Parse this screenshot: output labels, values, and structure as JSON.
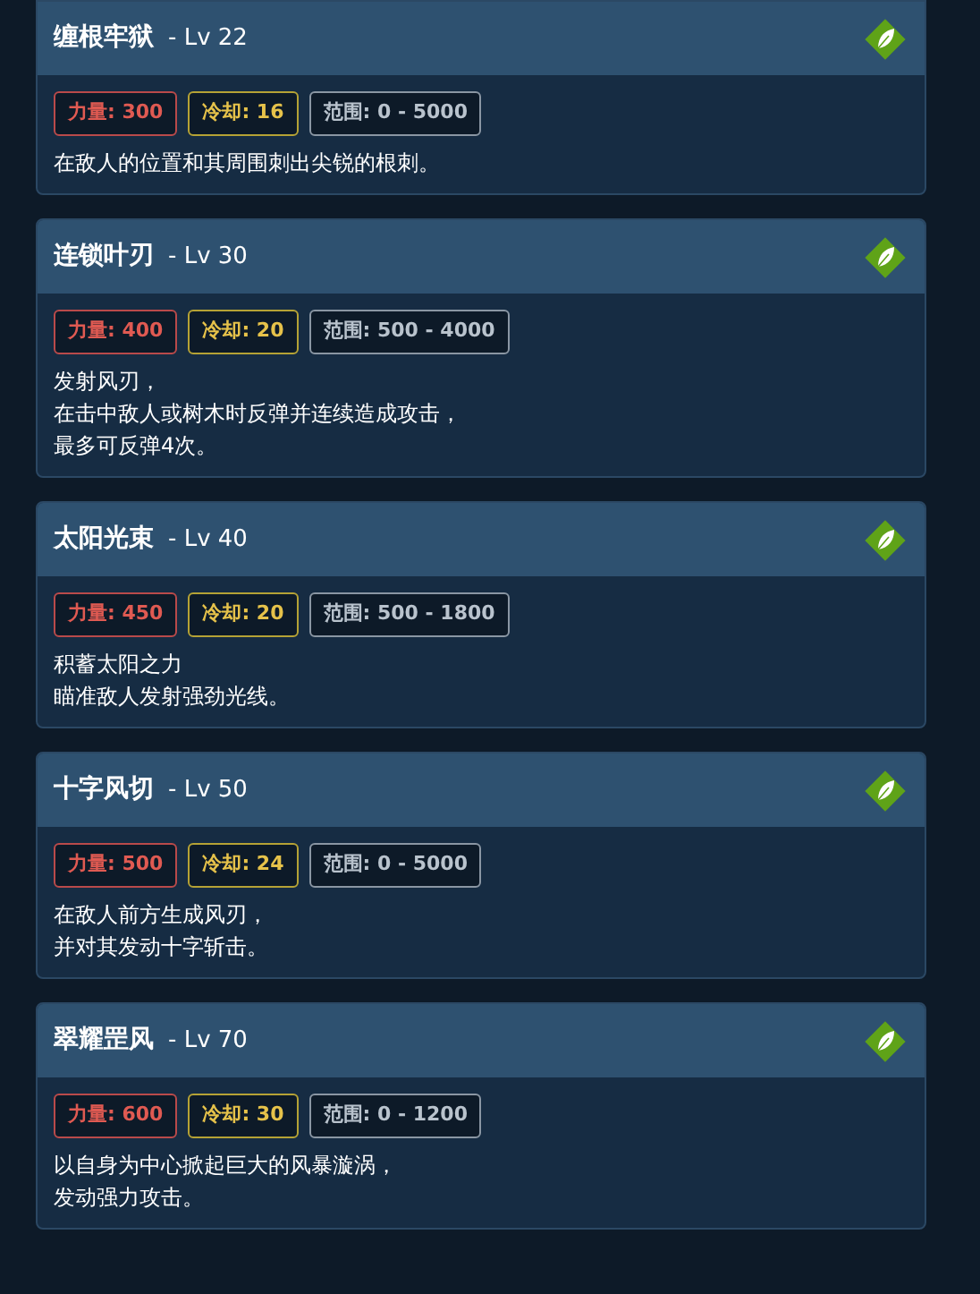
{
  "skills": [
    {
      "name": "缠根牢狱",
      "level": "- Lv 22",
      "kind": "leaf",
      "stats": [
        {
          "kind": "power",
          "text": "力量: 300"
        },
        {
          "kind": "cooldown",
          "text": "冷却: 16"
        },
        {
          "kind": "range",
          "text": "范围: 0 - 5000"
        }
      ],
      "description": [
        "在敌人的位置和其周围刺出尖锐的根刺。"
      ]
    },
    {
      "name": "连锁叶刃",
      "level": "- Lv 30",
      "kind": "leaf",
      "stats": [
        {
          "kind": "power",
          "text": "力量: 400"
        },
        {
          "kind": "cooldown",
          "text": "冷却: 20"
        },
        {
          "kind": "range",
          "text": "范围: 500 - 4000"
        }
      ],
      "description": [
        "发射风刃，",
        "在击中敌人或树木时反弹并连续造成攻击，",
        "最多可反弹4次。"
      ]
    },
    {
      "name": "太阳光束",
      "level": "- Lv 40",
      "kind": "leaf",
      "stats": [
        {
          "kind": "power",
          "text": "力量: 450"
        },
        {
          "kind": "cooldown",
          "text": "冷却: 20"
        },
        {
          "kind": "range",
          "text": "范围: 500 - 1800"
        }
      ],
      "description": [
        "积蓄太阳之力",
        "瞄准敌人发射强劲光线。"
      ]
    },
    {
      "name": "十字风切",
      "level": "- Lv 50",
      "kind": "leaf",
      "stats": [
        {
          "kind": "power",
          "text": "力量: 500"
        },
        {
          "kind": "cooldown",
          "text": "冷却: 24"
        },
        {
          "kind": "range",
          "text": "范围: 0 - 5000"
        }
      ],
      "description": [
        "在敌人前方生成风刃，",
        "并对其发动十字斩击。"
      ]
    },
    {
      "name": "翠耀罡风",
      "level": "- Lv 70",
      "kind": "leaf",
      "stats": [
        {
          "kind": "power",
          "text": "力量: 600"
        },
        {
          "kind": "cooldown",
          "text": "冷却: 30"
        },
        {
          "kind": "range",
          "text": "范围: 0 - 1200"
        }
      ],
      "description": [
        "以自身为中心掀起巨大的风暴漩涡，",
        "发动强力攻击。"
      ]
    }
  ]
}
